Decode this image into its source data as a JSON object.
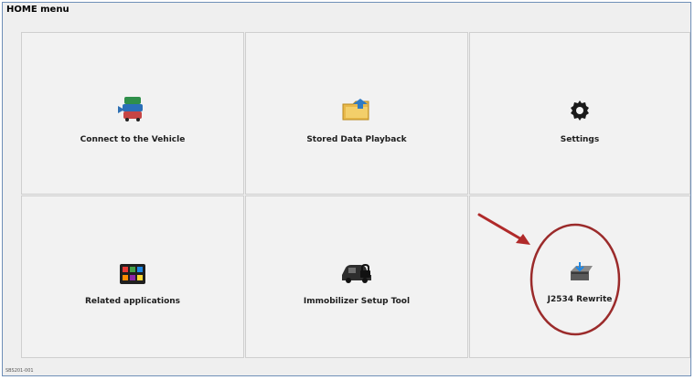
{
  "window": {
    "title": "HOME menu"
  },
  "tiles": [
    {
      "label": "Connect to the Vehicle",
      "icon": "vehicles-icon"
    },
    {
      "label": "Stored Data Playback",
      "icon": "folder-icon"
    },
    {
      "label": "Settings",
      "icon": "gear-icon"
    },
    {
      "label": "Related applications",
      "icon": "apps-grid-icon"
    },
    {
      "label": "Immobilizer Setup Tool",
      "icon": "car-lock-icon"
    },
    {
      "label": "J2534 Rewrite",
      "icon": "ecu-download-icon"
    }
  ],
  "annotations": {
    "arrow_color": "#b02a2a",
    "circle_color": "#9b2b2b"
  },
  "footer": {
    "code": "SBS201-001"
  }
}
